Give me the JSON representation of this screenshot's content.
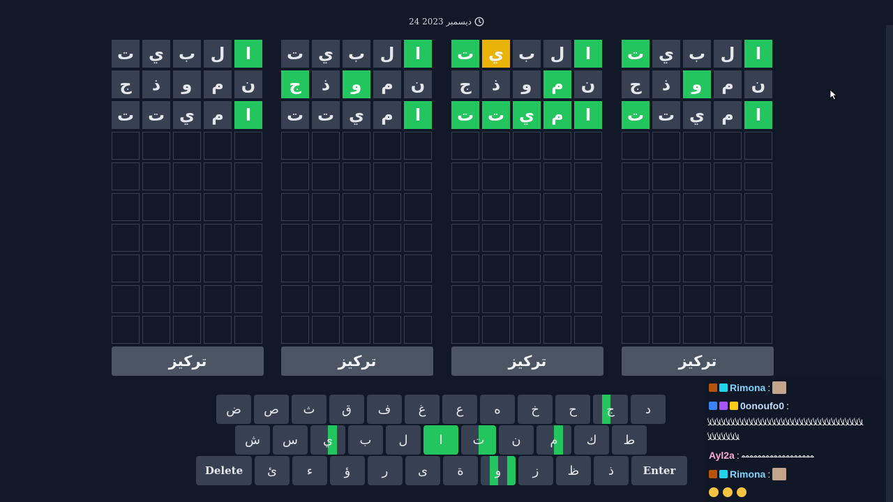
{
  "date": "24 ديسمبر 2023",
  "focus_label": "تركيز",
  "rows_per_board": 10,
  "boards": [
    {
      "name": "board-1",
      "rows": [
        [
          [
            "ت",
            "f"
          ],
          [
            "ي",
            "f"
          ],
          [
            "ب",
            "f"
          ],
          [
            "ل",
            "f"
          ],
          [
            "ا",
            "c"
          ]
        ],
        [
          [
            "ج",
            "f"
          ],
          [
            "ذ",
            "f"
          ],
          [
            "و",
            "f"
          ],
          [
            "م",
            "f"
          ],
          [
            "ن",
            "f"
          ]
        ],
        [
          [
            "ت",
            "f"
          ],
          [
            "ت",
            "f"
          ],
          [
            "ي",
            "f"
          ],
          [
            "م",
            "f"
          ],
          [
            "ا",
            "c"
          ]
        ]
      ]
    },
    {
      "name": "board-2",
      "rows": [
        [
          [
            "ت",
            "f"
          ],
          [
            "ي",
            "f"
          ],
          [
            "ب",
            "f"
          ],
          [
            "ل",
            "f"
          ],
          [
            "ا",
            "c"
          ]
        ],
        [
          [
            "ج",
            "c"
          ],
          [
            "ذ",
            "f"
          ],
          [
            "و",
            "c"
          ],
          [
            "م",
            "f"
          ],
          [
            "ن",
            "f"
          ]
        ],
        [
          [
            "ت",
            "f"
          ],
          [
            "ت",
            "f"
          ],
          [
            "ي",
            "f"
          ],
          [
            "م",
            "f"
          ],
          [
            "ا",
            "c"
          ]
        ]
      ]
    },
    {
      "name": "board-3",
      "rows": [
        [
          [
            "ت",
            "c"
          ],
          [
            "ي",
            "p"
          ],
          [
            "ب",
            "f"
          ],
          [
            "ل",
            "f"
          ],
          [
            "ا",
            "c"
          ]
        ],
        [
          [
            "ج",
            "f"
          ],
          [
            "ذ",
            "f"
          ],
          [
            "و",
            "f"
          ],
          [
            "م",
            "c"
          ],
          [
            "ن",
            "f"
          ]
        ],
        [
          [
            "ت",
            "c"
          ],
          [
            "ت",
            "c"
          ],
          [
            "ي",
            "c"
          ],
          [
            "م",
            "c"
          ],
          [
            "ا",
            "c"
          ]
        ]
      ]
    },
    {
      "name": "board-4",
      "rows": [
        [
          [
            "ت",
            "c"
          ],
          [
            "ي",
            "f"
          ],
          [
            "ب",
            "f"
          ],
          [
            "ل",
            "f"
          ],
          [
            "ا",
            "c"
          ]
        ],
        [
          [
            "ج",
            "f"
          ],
          [
            "ذ",
            "f"
          ],
          [
            "و",
            "c"
          ],
          [
            "م",
            "f"
          ],
          [
            "ن",
            "f"
          ]
        ],
        [
          [
            "ت",
            "c"
          ],
          [
            "ت",
            "f"
          ],
          [
            "ي",
            "f"
          ],
          [
            "م",
            "f"
          ],
          [
            "ا",
            "c"
          ]
        ]
      ]
    }
  ],
  "keyboard": {
    "rows": [
      [
        {
          "label": "ض"
        },
        {
          "label": "ص"
        },
        {
          "label": "ث"
        },
        {
          "label": "ق"
        },
        {
          "label": "ف"
        },
        {
          "label": "غ"
        },
        {
          "label": "ع"
        },
        {
          "label": "ه"
        },
        {
          "label": "خ"
        },
        {
          "label": "ح"
        },
        {
          "label": "ج",
          "green": [
            0,
            1,
            0,
            0
          ]
        },
        {
          "label": "د"
        }
      ],
      [
        {
          "label": "ش"
        },
        {
          "label": "س"
        },
        {
          "label": "ي",
          "green": [
            0,
            0,
            1,
            0
          ]
        },
        {
          "label": "ب"
        },
        {
          "label": "ل"
        },
        {
          "label": "ا",
          "green": [
            1,
            1,
            1,
            1
          ]
        },
        {
          "label": "ت",
          "green": [
            0,
            0,
            1,
            1
          ]
        },
        {
          "label": "ن"
        },
        {
          "label": "م",
          "green": [
            0,
            0,
            1,
            0
          ]
        },
        {
          "label": "ك"
        },
        {
          "label": "ط"
        }
      ],
      [
        {
          "label": "Delete",
          "wide": true
        },
        {
          "label": "ئ"
        },
        {
          "label": "ء"
        },
        {
          "label": "ؤ"
        },
        {
          "label": "ر"
        },
        {
          "label": "ى"
        },
        {
          "label": "ة"
        },
        {
          "label": "و",
          "green": [
            0,
            1,
            0,
            1
          ]
        },
        {
          "label": "ز"
        },
        {
          "label": "ظ"
        },
        {
          "label": "ذ"
        },
        {
          "label": "Enter",
          "wide": true
        }
      ]
    ]
  },
  "chat": {
    "messages": [
      {
        "user": "Rimona",
        "user_color": "#7dd3fc",
        "text": ""
      },
      {
        "user": "0onoufo0",
        "user_color": "#bfdbfe",
        "text": ""
      },
      {
        "user": "",
        "user_color": "#ffffff",
        "text": "ﻸﻸﻸﻸﻸﻸﻸﻸﻸﻸﻸﻸﻸﻸﻸﻸﻸﻸﻸﻸﻸﻸﻸﻸﻸﻸﻸﻸﻸﻸﻸﻸﻸﻸ"
      },
      {
        "user": "",
        "user_color": "#ffffff",
        "text": "ﻸﻸﻸﻸﻸﻸﻸ"
      },
      {
        "user": "Ayl2a",
        "user_color": "#f9a8d4",
        "text": "ﻤﻤﻤﻤﻤﻤﻤﻤﻤﻤﻤﻤﻤﻤﻤﻤﻤﻤ"
      },
      {
        "user": "Rimona",
        "user_color": "#7dd3fc",
        "text": ""
      }
    ],
    "separator": " :",
    "emoji_count": 3
  },
  "colors": {
    "background": "#111827",
    "filled": "#374151",
    "correct": "#22c55e",
    "present": "#eab308",
    "button": "#4b5563"
  }
}
